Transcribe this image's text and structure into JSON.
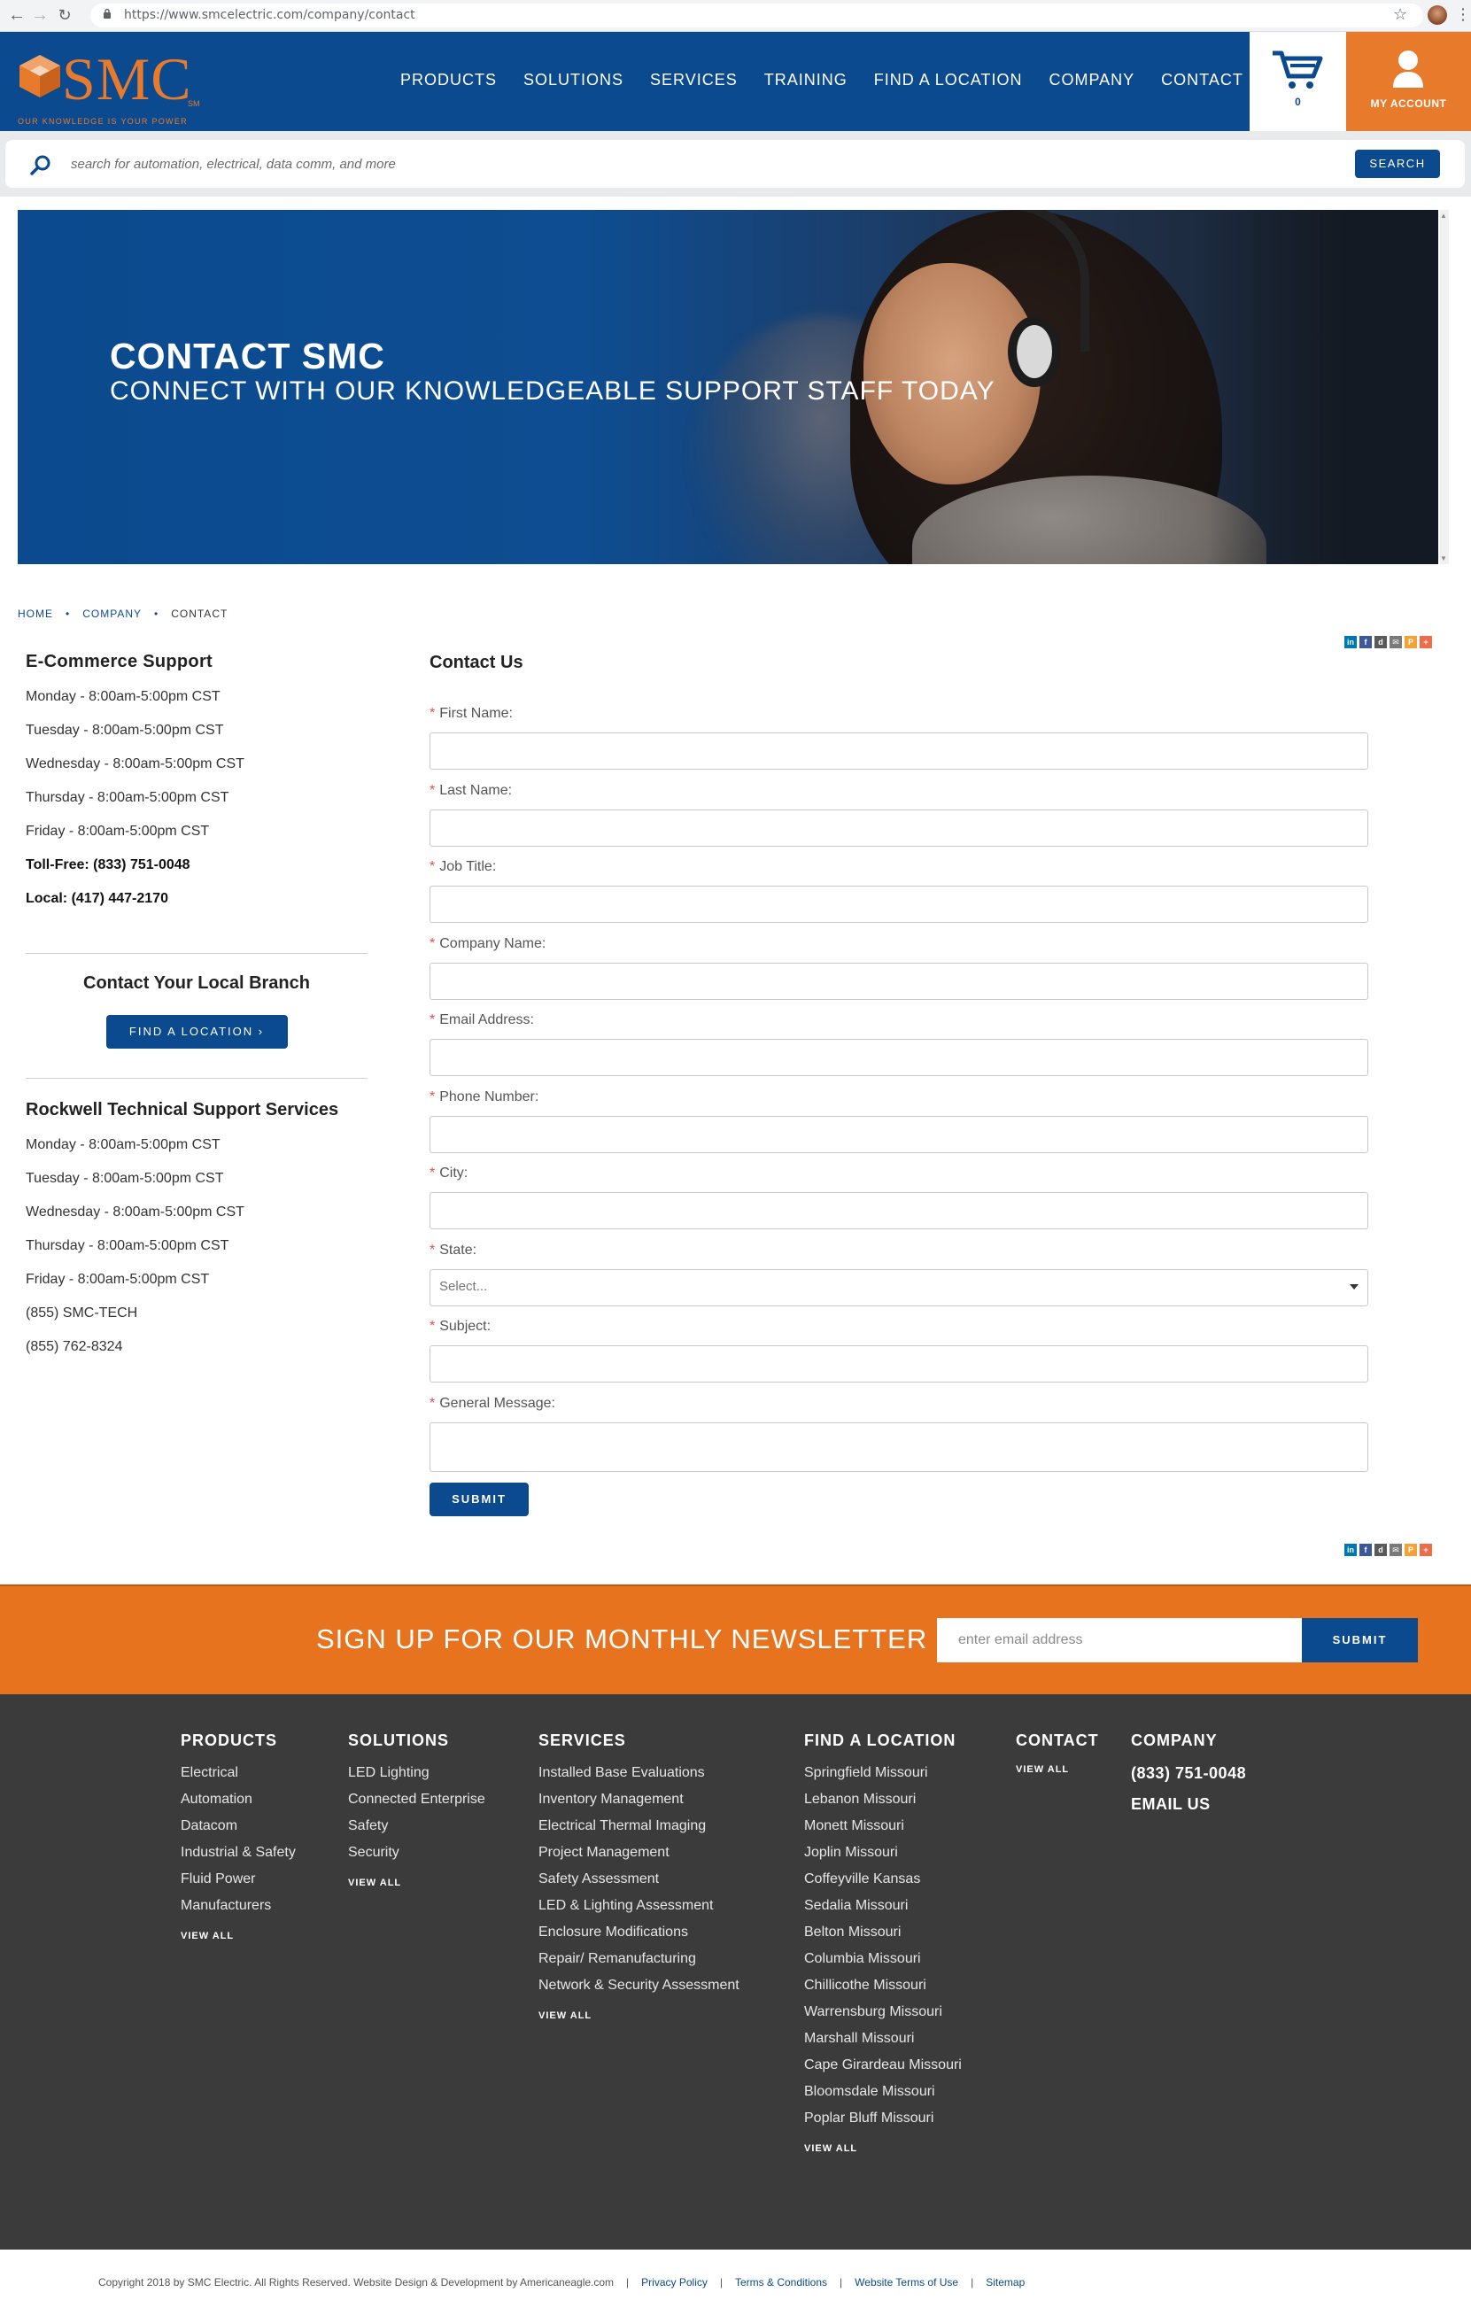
{
  "browser": {
    "url": "https://www.smcelectric.com/company/contact"
  },
  "header": {
    "logo_text": "SMC",
    "logo_sm": "SM",
    "logo_tagline": "OUR KNOWLEDGE IS YOUR POWER",
    "nav": [
      "PRODUCTS",
      "SOLUTIONS",
      "SERVICES",
      "TRAINING",
      "FIND A LOCATION",
      "COMPANY",
      "CONTACT"
    ],
    "cart_count": "0",
    "account_label": "MY ACCOUNT"
  },
  "search": {
    "placeholder": "search for automation, electrical, data comm, and more",
    "button": "SEARCH"
  },
  "hero": {
    "title": "CONTACT SMC",
    "subtitle": "CONNECT WITH OUR KNOWLEDGEABLE SUPPORT STAFF TODAY"
  },
  "breadcrumb": [
    "HOME",
    "COMPANY",
    "CONTACT"
  ],
  "ecommerce": {
    "title": "E-Commerce Support",
    "hours": [
      "Monday - 8:00am-5:00pm CST",
      "Tuesday - 8:00am-5:00pm CST",
      "Wednesday - 8:00am-5:00pm CST",
      "Thursday - 8:00am-5:00pm CST",
      "Friday - 8:00am-5:00pm CST"
    ],
    "tollfree": "Toll-Free: (833) 751-0048",
    "local": "Local: (417) 447-2170"
  },
  "branch": {
    "title": "Contact Your Local Branch",
    "button": "FIND A LOCATION ›"
  },
  "rockwell": {
    "title": "Rockwell Technical Support Services",
    "hours": [
      "Monday - 8:00am-5:00pm CST",
      "Tuesday - 8:00am-5:00pm CST",
      "Wednesday - 8:00am-5:00pm CST",
      "Thursday - 8:00am-5:00pm CST",
      "Friday - 8:00am-5:00pm CST"
    ],
    "phone1": "(855) SMC-TECH",
    "phone2": "(855) 762-8324"
  },
  "form": {
    "title": "Contact Us",
    "fields": [
      "First Name:",
      "Last Name:",
      "Job Title:",
      "Company Name:",
      "Email Address:",
      "Phone Number:",
      "City:",
      "State:",
      "Subject:",
      "General Message:"
    ],
    "state_value": "Select...",
    "submit": "SUBMIT"
  },
  "newsletter": {
    "text": "SIGN UP FOR OUR MONTHLY NEWSLETTER",
    "placeholder": "enter email address",
    "button": "SUBMIT"
  },
  "footer": {
    "products": {
      "title": "PRODUCTS",
      "links": [
        "Electrical",
        "Automation",
        "Datacom",
        "Industrial & Safety",
        "Fluid Power",
        "Manufacturers"
      ],
      "view_all": "VIEW ALL"
    },
    "solutions": {
      "title": "SOLUTIONS",
      "links": [
        "LED Lighting",
        "Connected Enterprise",
        "Safety",
        "Security"
      ],
      "view_all": "VIEW ALL"
    },
    "services": {
      "title": "SERVICES",
      "links": [
        "Installed Base Evaluations",
        "Inventory Management",
        "Electrical Thermal Imaging",
        "Project Management",
        "Safety Assessment",
        "LED & Lighting Assessment",
        "Enclosure Modifications",
        "Repair/ Remanufacturing",
        "Network & Security Assessment"
      ],
      "view_all": "VIEW ALL"
    },
    "locations": {
      "title": "FIND A LOCATION",
      "links": [
        "Springfield Missouri",
        "Lebanon Missouri",
        "Monett Missouri",
        "Joplin Missouri",
        "Coffeyville Kansas",
        "Sedalia Missouri",
        "Belton Missouri",
        "Columbia Missouri",
        "Chillicothe Missouri",
        "Warrensburg Missouri",
        "Marshall Missouri",
        "Cape Girardeau Missouri",
        "Bloomsdale Missouri",
        "Poplar Bluff Missouri"
      ],
      "view_all": "VIEW ALL"
    },
    "contact": {
      "title": "CONTACT",
      "view_all": "VIEW ALL"
    },
    "company": {
      "title": "COMPANY",
      "phone": "(833) 751-0048",
      "email": "EMAIL US"
    }
  },
  "bottom": {
    "copyright": "Copyright 2018 by SMC Electric. All Rights Reserved. Website Design & Development by Americaneagle.com",
    "links": [
      "Privacy Policy",
      "Terms & Conditions",
      "Website Terms of Use",
      "Sitemap"
    ]
  },
  "colors": {
    "brand_blue": "#0b4a8e",
    "brand_orange": "#e87a2c",
    "footer_bg": "#3b3b3b"
  },
  "share_icons": [
    "linkedin-icon",
    "facebook-icon",
    "delicious-icon",
    "email-icon",
    "print-icon",
    "plus-icon"
  ]
}
